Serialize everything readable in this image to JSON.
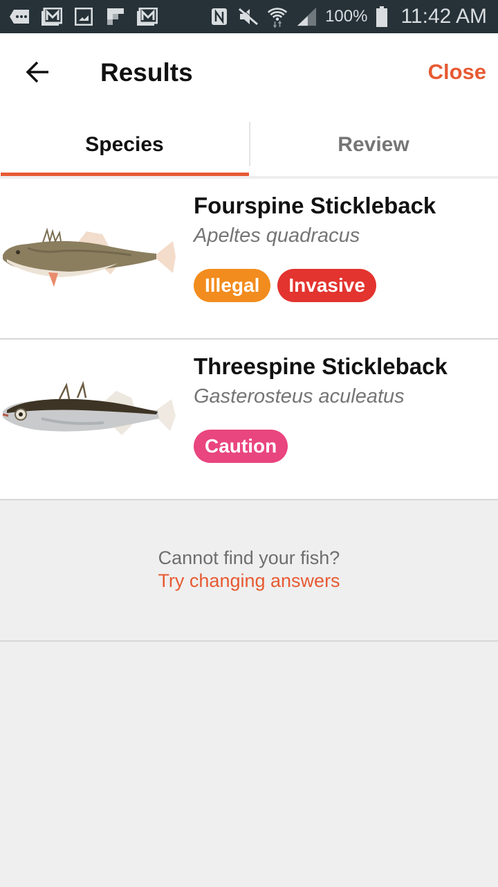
{
  "status_bar": {
    "notification_icons": [
      "more-icon",
      "gmail-icon",
      "gallery-icon",
      "flipboard-icon",
      "gmail-icon"
    ],
    "system_icons": [
      "nfc-icon",
      "mute-icon",
      "wifi-icon",
      "signal-icon"
    ],
    "battery": "100%",
    "time": "11:42 AM"
  },
  "header": {
    "title": "Results",
    "close_label": "Close",
    "accent_color": "#e75a33"
  },
  "tabs": [
    {
      "label": "Species",
      "active": true
    },
    {
      "label": "Review",
      "active": false
    }
  ],
  "results": [
    {
      "name": "Fourspine Stickleback",
      "scientific_name": "Apeltes quadracus",
      "image": "fourspine-stickleback-image",
      "badges": [
        {
          "label": "Illegal",
          "color": "#f28c1e"
        },
        {
          "label": "Invasive",
          "color": "#e3342f"
        }
      ]
    },
    {
      "name": "Threespine Stickleback",
      "scientific_name": "Gasterosteus aculeatus",
      "image": "threespine-stickleback-image",
      "badges": [
        {
          "label": "Caution",
          "color": "#e9457e"
        }
      ]
    }
  ],
  "footer": {
    "question": "Cannot find your fish?",
    "link": "Try changing answers"
  }
}
